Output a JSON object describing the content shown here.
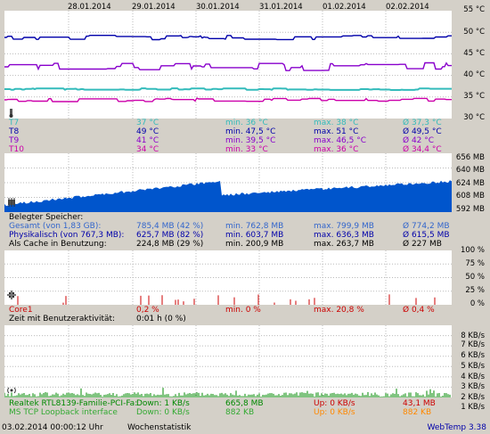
{
  "dates": [
    "28.01.2014",
    "29.01.2014",
    "30.01.2014",
    "31.01.2014",
    "01.02.2014",
    "02.02.2014"
  ],
  "temp": {
    "yticks": [
      "55 °C",
      "50 °C",
      "45 °C",
      "40 °C",
      "35 °C",
      "30 °C"
    ],
    "rows": [
      {
        "name": "T7",
        "cur": "37 °C",
        "min": "min. 36 °C",
        "max": "max. 38 °C",
        "avg": "Ø 37,3 °C",
        "color": "#33bbbb"
      },
      {
        "name": "T8",
        "cur": "49 °C",
        "min": "min. 47,5 °C",
        "max": "max. 51 °C",
        "avg": "Ø 49,5 °C",
        "color": "#0000aa"
      },
      {
        "name": "T9",
        "cur": "41 °C",
        "min": "min. 39,5 °C",
        "max": "max. 46,5 °C",
        "avg": "Ø 42 °C",
        "color": "#8800cc"
      },
      {
        "name": "T10",
        "cur": "34 °C",
        "min": "min. 33 °C",
        "max": "max. 36 °C",
        "avg": "Ø 34,4 °C",
        "color": "#cc00aa"
      }
    ]
  },
  "mem": {
    "yticks": [
      "656 MB",
      "640 MB",
      "624 MB",
      "608 MB",
      "592 MB"
    ],
    "heading": "Belegter Speicher:",
    "rows": [
      {
        "name": "Gesamt (von 1,83 GB):",
        "cur": "785,4 MB (42 %)",
        "min": "min. 762,8 MB",
        "max": "max. 799,9 MB",
        "avg": "Ø 774,2 MB",
        "color": "#3366cc"
      },
      {
        "name": "Physikalisch (von 767,3 MB):",
        "cur": "625,7 MB (82 %)",
        "min": "min. 603,7 MB",
        "max": "max. 636,3 MB",
        "avg": "Ø 615,5 MB",
        "color": "#0000aa"
      },
      {
        "name": "Als Cache in Benutzung:",
        "cur": "224,8 MB (29 %)",
        "min": "min. 200,9 MB",
        "max": "max. 263,7 MB",
        "avg": "Ø 227 MB",
        "color": "#000000"
      }
    ]
  },
  "cpu": {
    "yticks": [
      "100 %",
      "75 %",
      "50 %",
      "25 %",
      "0 %"
    ],
    "rows": [
      {
        "name": "Core1",
        "cur": "0,2 %",
        "min": "min. 0 %",
        "max": "max. 20,8 %",
        "avg": "Ø 0,4 %",
        "color": "#cc0000"
      }
    ],
    "activity_label": "Zeit mit Benutzeraktivität:",
    "activity_value": "0:01 h (0 %)"
  },
  "net": {
    "yticks": [
      "8 KB/s",
      "7 KB/s",
      "6 KB/s",
      "5 KB/s",
      "4 KB/s",
      "3 KB/s",
      "2 KB/s",
      "1 KB/s"
    ],
    "rows": [
      {
        "name": "Realtek RTL8139-Familie-PCI-Fa:",
        "down": "Down: 1 KB/s",
        "downtotal": "665,8 MB",
        "up": "Up: 0 KB/s",
        "uptotal": "43,1 MB",
        "color": "#008800",
        "upcolor": "#cc0000"
      },
      {
        "name": "MS TCP Loopback interface",
        "down": "Down: 0 KB/s",
        "downtotal": "882 KB",
        "up": "Up: 0 KB/s",
        "uptotal": "882 KB",
        "color": "#33aa33",
        "upcolor": "#ff8800"
      }
    ]
  },
  "footer": {
    "timestamp": "03.02.2014 00:00:12 Uhr",
    "mode": "Wochenstatistik",
    "app": "WebTemp 3.38"
  }
}
